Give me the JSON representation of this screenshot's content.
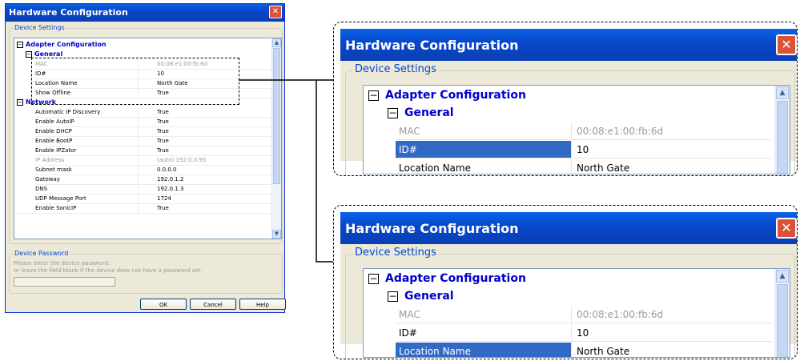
{
  "dialog": {
    "title": "Hardware Configuration",
    "device_settings_label": "Device Settings",
    "category": "Adapter Configuration",
    "general": "General",
    "network": "Network",
    "general_props": [
      {
        "name": "MAC",
        "value": "00:08:e1:00:fb:6d",
        "disabled": true
      },
      {
        "name": "ID#",
        "value": "10",
        "disabled": false
      },
      {
        "name": "Location Name",
        "value": "North Gate",
        "disabled": false
      },
      {
        "name": "Show Offline",
        "value": "True",
        "disabled": false
      }
    ],
    "network_props": [
      {
        "name": "Automatic IP Discovery",
        "value": "True",
        "disabled": false
      },
      {
        "name": "Enable AutoIP",
        "value": "True",
        "disabled": false
      },
      {
        "name": "Enable DHCP",
        "value": "True",
        "disabled": false
      },
      {
        "name": "Enable BootP",
        "value": "True",
        "disabled": false
      },
      {
        "name": "Enable IPZator",
        "value": "True",
        "disabled": false
      },
      {
        "name": "IP Address",
        "value": "(auto) 192.0.0.95",
        "disabled": true
      },
      {
        "name": "Subnet mask",
        "value": "0.0.0.0",
        "disabled": false
      },
      {
        "name": "Gateway",
        "value": "192.0.1.2",
        "disabled": false
      },
      {
        "name": "DNS",
        "value": "192.0.1.3",
        "disabled": false
      },
      {
        "name": "UDP Message Port",
        "value": "1724",
        "disabled": false
      },
      {
        "name": "Enable SonicIP",
        "value": "True",
        "disabled": false
      }
    ],
    "device_password_label": "Device Password",
    "password_hint_line1": "Please enter the device password,",
    "password_hint_line2": "or leave the field blank if the device does not have a password set.",
    "buttons": {
      "ok": "OK",
      "cancel": "Cancel",
      "help": "Help"
    }
  },
  "zoom_top": {
    "title": "Hardware Configuration",
    "device_settings_label": "Device Settings",
    "category": "Adapter Configuration",
    "general": "General",
    "rows": [
      {
        "name": "MAC",
        "value": "00:08:e1:00:fb:6d"
      },
      {
        "name": "ID#",
        "value": "10"
      },
      {
        "name": "Location Name",
        "value": "North Gate"
      }
    ],
    "selected_row": "ID#"
  },
  "zoom_bottom": {
    "title": "Hardware Configuration",
    "device_settings_label": "Device Settings",
    "category": "Adapter Configuration",
    "general": "General",
    "rows": [
      {
        "name": "MAC",
        "value": "00:08:e1:00:fb:6d"
      },
      {
        "name": "ID#",
        "value": "10"
      },
      {
        "name": "Location Name",
        "value": "North Gate"
      }
    ],
    "selected_row": "Location Name"
  },
  "icons": {
    "close": "close-icon",
    "collapse": "collapse-box-icon",
    "scroll_up": "scroll-up-arrow-icon",
    "scroll_down": "scroll-down-arrow-icon"
  },
  "colors": {
    "titlebar": "#0a4fd4",
    "category_text": "#0000cc",
    "selection": "#316ac5",
    "dialog_face": "#ece9d8"
  }
}
